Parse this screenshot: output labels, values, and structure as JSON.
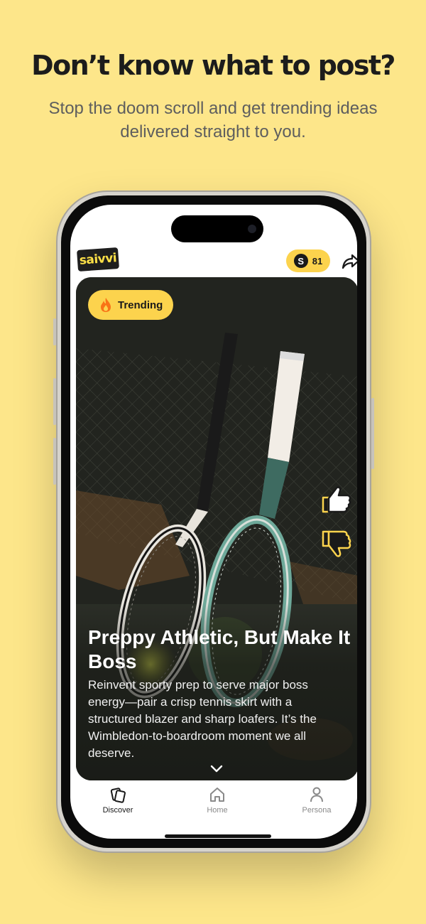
{
  "marketing": {
    "headline": "Don’t know what to post?",
    "subline": "Stop the doom scroll and get trending ideas delivered straight to you."
  },
  "app": {
    "logo_text": "saivvi",
    "coin_count": "81",
    "coin_symbol": "S"
  },
  "card": {
    "badge_label": "Trending",
    "title": "Preppy Athletic, But Make It Boss",
    "description": "Reinvent sporty prep to serve major boss energy—pair a crisp tennis skirt with a structured blazer and sharp loafers. It’s the Wimbledon-to-boardroom moment we all deserve."
  },
  "tabs": [
    {
      "label": "Discover",
      "active": true
    },
    {
      "label": "Home",
      "active": false
    },
    {
      "label": "Persona",
      "active": false
    }
  ],
  "icons": {
    "badge": "flame-icon",
    "share": "share-arrow-icon",
    "like": "thumbs-up-icon",
    "dislike": "thumbs-down-icon",
    "expand": "chevron-down-icon"
  },
  "colors": {
    "background": "#fde68a",
    "accent": "#fcd34d",
    "text_dark": "#1c1c1c"
  }
}
